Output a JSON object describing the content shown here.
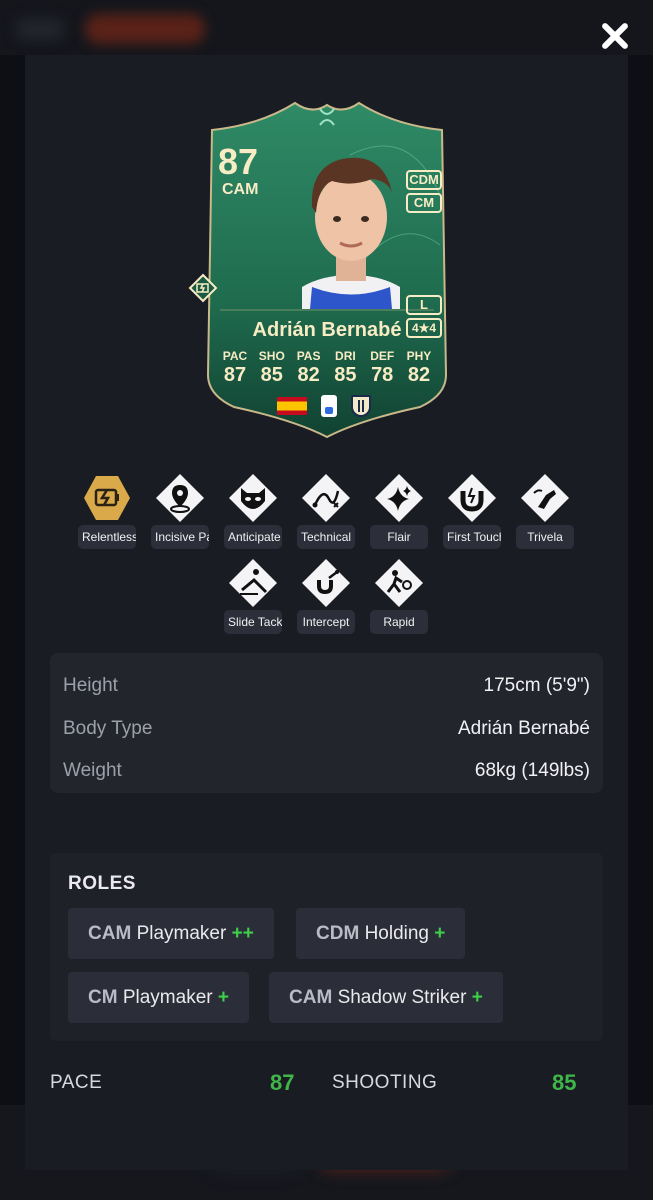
{
  "card": {
    "rating": "87",
    "position": "CAM",
    "alt_positions": [
      "CDM",
      "CM"
    ],
    "foot": "L",
    "skill_weak": "4★4",
    "name": "Adrián Bernabé",
    "stats": [
      {
        "k": "PAC",
        "v": "87"
      },
      {
        "k": "SHO",
        "v": "85"
      },
      {
        "k": "PAS",
        "v": "82"
      },
      {
        "k": "DRI",
        "v": "85"
      },
      {
        "k": "DEF",
        "v": "78"
      },
      {
        "k": "PHY",
        "v": "82"
      }
    ],
    "accent": "#1e6b4e",
    "text_color": "#f7ecc4"
  },
  "playstyles_row1": [
    {
      "label": "Relentless",
      "icon": "battery-bolt-icon",
      "plus": true
    },
    {
      "label": "Incisive Pass",
      "icon": "location-pin-icon",
      "plus": false
    },
    {
      "label": "Anticipate",
      "icon": "raccoon-icon",
      "plus": false
    },
    {
      "label": "Technical",
      "icon": "dribble-path-icon",
      "plus": false
    },
    {
      "label": "Flair",
      "icon": "sparkle-icon",
      "plus": false
    },
    {
      "label": "First Touch",
      "icon": "magnet-icon",
      "plus": false
    },
    {
      "label": "Trivela",
      "icon": "boot-kick-icon",
      "plus": false
    }
  ],
  "playstyles_row2": [
    {
      "label": "Slide Tackle",
      "icon": "slide-tackle-icon"
    },
    {
      "label": "Intercept",
      "icon": "intercept-icon"
    },
    {
      "label": "Rapid",
      "icon": "running-ball-icon"
    }
  ],
  "info": [
    {
      "k": "Height",
      "v": "175cm (5'9\")"
    },
    {
      "k": "Body Type",
      "v": "Adrián Bernabé"
    },
    {
      "k": "Weight",
      "v": "68kg (149lbs)"
    }
  ],
  "roles": {
    "title": "ROLES",
    "items": [
      {
        "pos": "CAM",
        "name": "Playmaker",
        "plus": "++"
      },
      {
        "pos": "CDM",
        "name": "Holding",
        "plus": "+"
      },
      {
        "pos": "CM",
        "name": "Playmaker",
        "plus": "+"
      },
      {
        "pos": "CAM",
        "name": "Shadow Striker",
        "plus": "+"
      }
    ]
  },
  "bottom_stats": [
    {
      "k": "PACE",
      "v": "87"
    },
    {
      "k": "SHOOTING",
      "v": "85"
    }
  ]
}
